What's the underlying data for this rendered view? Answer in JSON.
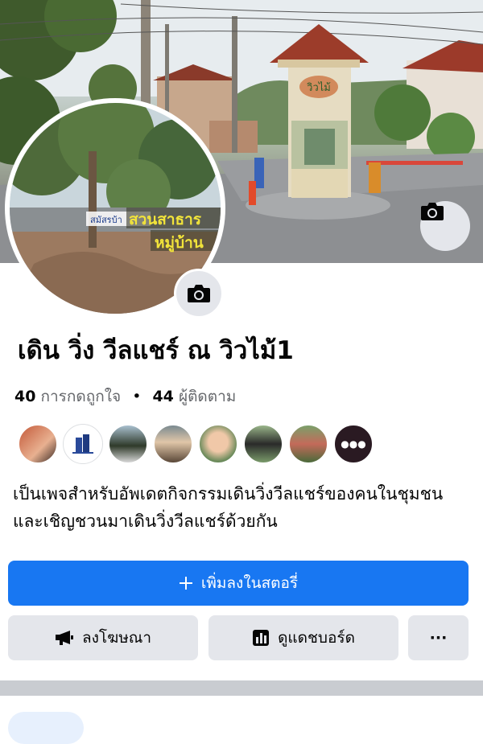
{
  "page": {
    "title": "เดิน วิ่ง วีลแชร์ ณ วิวไม้1",
    "likes_count": "40",
    "likes_label": "การกดถูกใจ",
    "separator": "•",
    "followers_count": "44",
    "followers_label": "ผู้ติดตาม",
    "bio": "เป็นเพจสำหรับอัพเดตกิจกรรมเดินวิ่งวีลแชร์ของคนในชุมชน และเชิญชวนมาเดินวิ่งวีลแชร์ด้วยกัน"
  },
  "cover": {
    "sign_text": "วิวไม้"
  },
  "avatar": {
    "sign_small": "สมัสรบ้า",
    "sign_line1": "สวนสาธาร",
    "sign_line2": "หมู่บ้าน"
  },
  "actions": {
    "add_story": "เพิ่มลงในสตอรี่",
    "add_story_icon": "plus-icon",
    "advertise": "ลงโฆษณา",
    "advertise_icon": "megaphone-icon",
    "dashboard": "ดูแดชบอร์ด",
    "dashboard_icon": "bar-chart-icon",
    "more": "···",
    "camera_icon": "camera-icon"
  },
  "colors": {
    "primary": "#1877f2",
    "secondary_bg": "#e4e6eb",
    "text": "#050505",
    "muted": "#65676b"
  }
}
